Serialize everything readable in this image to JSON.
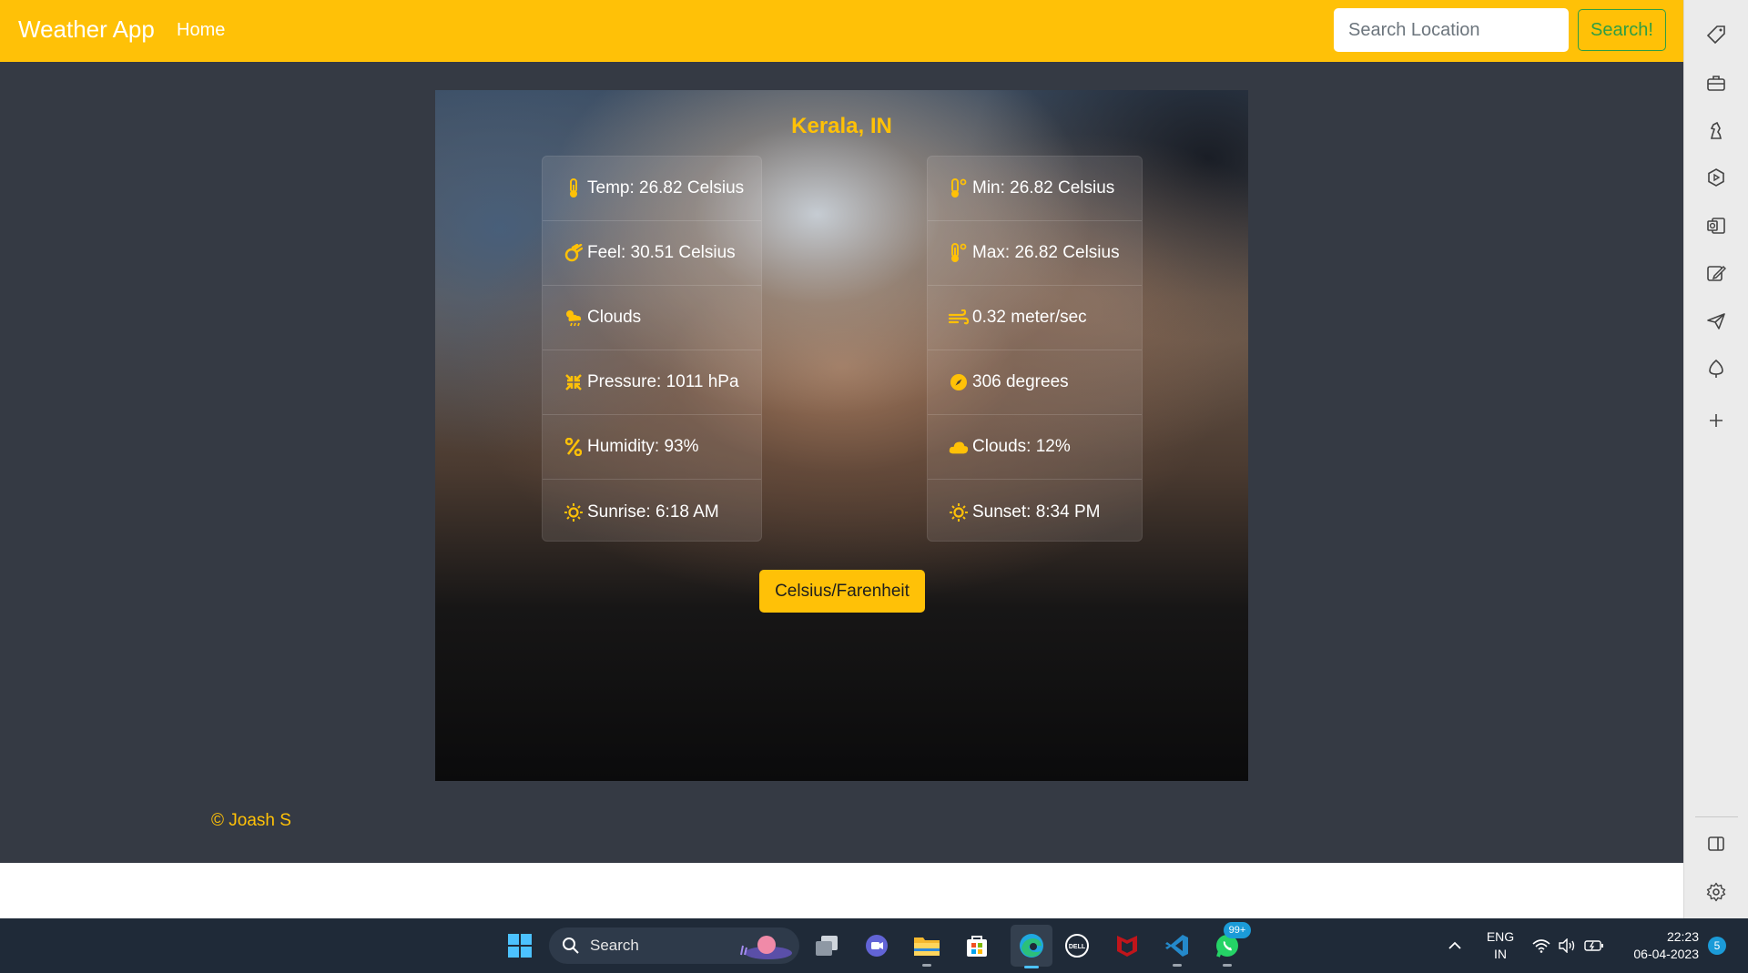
{
  "navbar": {
    "brand": "Weather App",
    "home_link": "Home",
    "search_placeholder": "Search Location",
    "search_button": "Search!"
  },
  "weather": {
    "location": "Kerala, IN",
    "left": [
      {
        "icon": "thermometer-icon",
        "text": "Temp: 26.82 Celsius"
      },
      {
        "icon": "meteor-icon",
        "text": "Feel: 30.51 Celsius"
      },
      {
        "icon": "cloud-sun-rain-icon",
        "text": "Clouds"
      },
      {
        "icon": "compress-arrows-icon",
        "text": "Pressure: 1011 hPa"
      },
      {
        "icon": "percent-icon",
        "text": "Humidity: 93%"
      },
      {
        "icon": "sun-icon",
        "text": "Sunrise: 6:18 AM"
      }
    ],
    "right": [
      {
        "icon": "temperature-low-icon",
        "text": "Min: 26.82 Celsius"
      },
      {
        "icon": "temperature-high-icon",
        "text": "Max: 26.82 Celsius"
      },
      {
        "icon": "wind-icon",
        "text": "0.32 meter/sec"
      },
      {
        "icon": "compass-icon",
        "text": "306 degrees"
      },
      {
        "icon": "cloud-icon",
        "text": "Clouds: 12%"
      },
      {
        "icon": "sun-icon",
        "text": "Sunset: 8:34 PM"
      }
    ],
    "toggle_button": "Celsius/Farenheit"
  },
  "footer": {
    "text": "© Joash S"
  },
  "edge_sidebar": {
    "icons": [
      "tag-icon",
      "toolbox-icon",
      "chess-icon",
      "games-icon",
      "outlook-icon",
      "drawing-icon",
      "send-icon",
      "tree-icon",
      "add-icon"
    ],
    "bottom_icons": [
      "split-screen-icon",
      "settings-icon"
    ]
  },
  "taskbar": {
    "search_label": "Search",
    "whatsapp_badge": "99+",
    "language": "ENG",
    "region": "IN",
    "time": "22:23",
    "date": "06-04-2023",
    "notification_count": "5"
  },
  "colors": {
    "accent": "#ffc107",
    "background": "#353a44",
    "taskbar": "#1f2a38"
  }
}
